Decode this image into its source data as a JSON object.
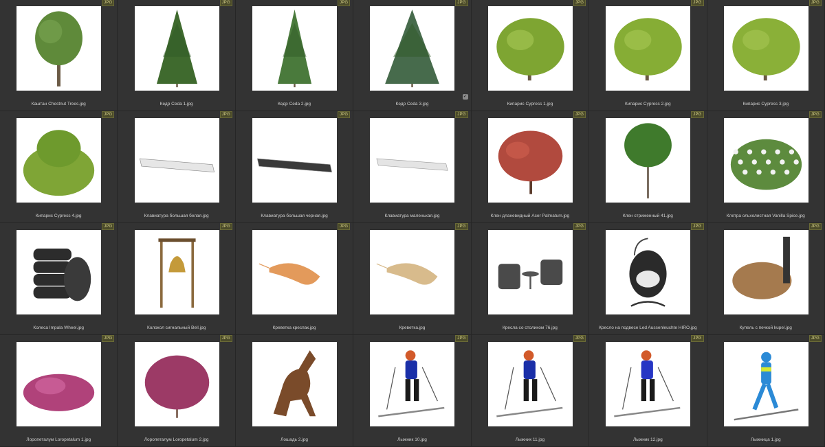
{
  "grid": {
    "badge_text": "JPG",
    "items": [
      {
        "name": "Каштан Chestnut Trees.jpg",
        "type": "deciduous",
        "color": "#5f8a3a",
        "badge": true
      },
      {
        "name": "Кедр Ceda 1.jpg",
        "type": "conifer",
        "color": "#3f6a2e",
        "badge": true
      },
      {
        "name": "Кедр Ceda 2.jpg",
        "type": "conifer-thin",
        "color": "#4a7a3c",
        "badge": true
      },
      {
        "name": "Кедр Ceda 3.jpg",
        "type": "conifer-wide",
        "color": "#476b4c",
        "badge": true,
        "selected": true
      },
      {
        "name": "Кипарис Cypress 1.jpg",
        "type": "shrub-tree",
        "color": "#7ea532",
        "badge": true
      },
      {
        "name": "Кипарис Cypress 2.jpg",
        "type": "shrub-tree",
        "color": "#86ad35",
        "badge": true
      },
      {
        "name": "Кипарис Cypress 3.jpg",
        "type": "shrub-tree",
        "color": "#8ab038",
        "badge": true
      },
      {
        "name": "Кипарис Cypress 4.jpg",
        "type": "bush",
        "color": "#7fa536",
        "badge": true
      },
      {
        "name": "Клавиатура большая белая.jpg",
        "type": "keyboard",
        "color": "#e6e6e6",
        "badge": true
      },
      {
        "name": "Клавиатура большая черная.jpg",
        "type": "keyboard",
        "color": "#3a3a3a",
        "badge": true
      },
      {
        "name": "Клавиатура маленькая.jpg",
        "type": "keyboard-small",
        "color": "#e4e4e4",
        "badge": true
      },
      {
        "name": "Клен дланевидный Acer Palmatum.jpg",
        "type": "maple",
        "color": "#b14a3e",
        "badge": true
      },
      {
        "name": "Клен стриженный 41.jpg",
        "type": "ball-tree",
        "color": "#3f7a2c",
        "badge": true
      },
      {
        "name": "Клетра ольхолистная Vanilla Spice.jpg",
        "type": "flower-bush",
        "color": "#5d8b3e",
        "badge": true
      },
      {
        "name": "Колеса Impala Wheel.jpg",
        "type": "tires",
        "color": "#2c2c2c",
        "badge": true
      },
      {
        "name": "Колокол сигнальный Bell.jpg",
        "type": "bell",
        "color": "#8b6a3e",
        "badge": true
      },
      {
        "name": "Креветка креспак.jpg",
        "type": "shrimp",
        "color": "#e39a5b",
        "badge": true
      },
      {
        "name": "Креветка.jpg",
        "type": "shrimp",
        "color": "#d8bb8c",
        "badge": true
      },
      {
        "name": "Кресла со столиком 76.jpg",
        "type": "chairs",
        "color": "#4a4a4a",
        "badge": true
      },
      {
        "name": "Кресло на подвесе Led Aussenleuchte HIRO.jpg",
        "type": "hanging-chair",
        "color": "#2a2a2a",
        "badge": true
      },
      {
        "name": "Купель с печкой kupel.jpg",
        "type": "tub",
        "color": "#a57a4e",
        "badge": true
      },
      {
        "name": "Лоропеталум Loropetalum 1.jpg",
        "type": "pink-bush",
        "color": "#b0427a",
        "badge": true
      },
      {
        "name": "Лоропеталум Loropetalum 2.jpg",
        "type": "pink-bush-tall",
        "color": "#9c3a66",
        "badge": true
      },
      {
        "name": "Лошадь 2.jpg",
        "type": "horse",
        "color": "#7a4b2a",
        "badge": false
      },
      {
        "name": "Лыжник 10.jpg",
        "type": "skier",
        "color": "#1a2fa8",
        "badge": true
      },
      {
        "name": "Лыжник 11.jpg",
        "type": "skier",
        "color": "#1a2fa8",
        "badge": true
      },
      {
        "name": "Лыжник 12.jpg",
        "type": "skier",
        "color": "#2636c4",
        "badge": true
      },
      {
        "name": "Лыжница 1.jpg",
        "type": "skier-blue",
        "color": "#2b8ad6",
        "badge": true
      }
    ]
  }
}
